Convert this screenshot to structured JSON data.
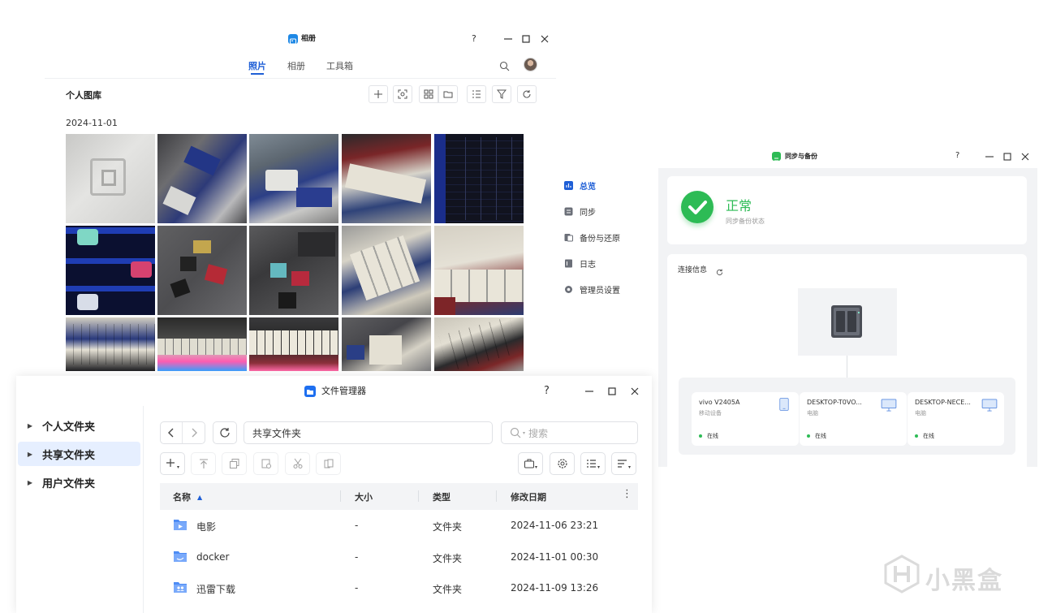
{
  "photos": {
    "title": "相册",
    "tabs": [
      "照片",
      "相册",
      "工具箱"
    ],
    "active_tab": "照片",
    "library_title": "个人图库",
    "date": "2024-11-01",
    "help": "?"
  },
  "sync": {
    "title": "同步与备份",
    "help": "?",
    "nav": [
      {
        "label": "总览",
        "icon": "chart-icon",
        "active": true
      },
      {
        "label": "同步",
        "icon": "sync-doc-icon"
      },
      {
        "label": "备份与还原",
        "icon": "backup-icon"
      },
      {
        "label": "日志",
        "icon": "log-icon"
      },
      {
        "label": "管理员设置",
        "icon": "settings-icon"
      }
    ],
    "status_title": "正常",
    "status_sub": "同步备份状态",
    "conn_title": "连接信息",
    "devices": [
      {
        "name": "vivo V2405A",
        "type": "移动设备",
        "status": "在线",
        "icon": "phone-icon"
      },
      {
        "name": "DESKTOP-T0VO...",
        "type": "电脑",
        "status": "在线",
        "icon": "monitor-icon"
      },
      {
        "name": "DESKTOP-NECE...",
        "type": "电脑",
        "status": "在线",
        "icon": "monitor-icon"
      }
    ],
    "colors": {
      "accent": "#2dbb55",
      "brand": "#1f5fd6"
    }
  },
  "files": {
    "title": "文件管理器",
    "help": "?",
    "tree": [
      {
        "label": "个人文件夹",
        "active": false
      },
      {
        "label": "共享文件夹",
        "active": true
      },
      {
        "label": "用户文件夹",
        "active": false
      }
    ],
    "path": "共享文件夹",
    "search_placeholder": "搜索",
    "columns": [
      "名称",
      "大小",
      "类型",
      "修改日期"
    ],
    "rows": [
      {
        "name": "电影",
        "size": "-",
        "type": "文件夹",
        "modified": "2024-11-06 23:21"
      },
      {
        "name": "docker",
        "size": "-",
        "type": "文件夹",
        "modified": "2024-11-01 00:30"
      },
      {
        "name": "迅雷下载",
        "size": "-",
        "type": "文件夹",
        "modified": "2024-11-09 13:26"
      }
    ]
  },
  "watermark": {
    "text": "小黑盒"
  }
}
